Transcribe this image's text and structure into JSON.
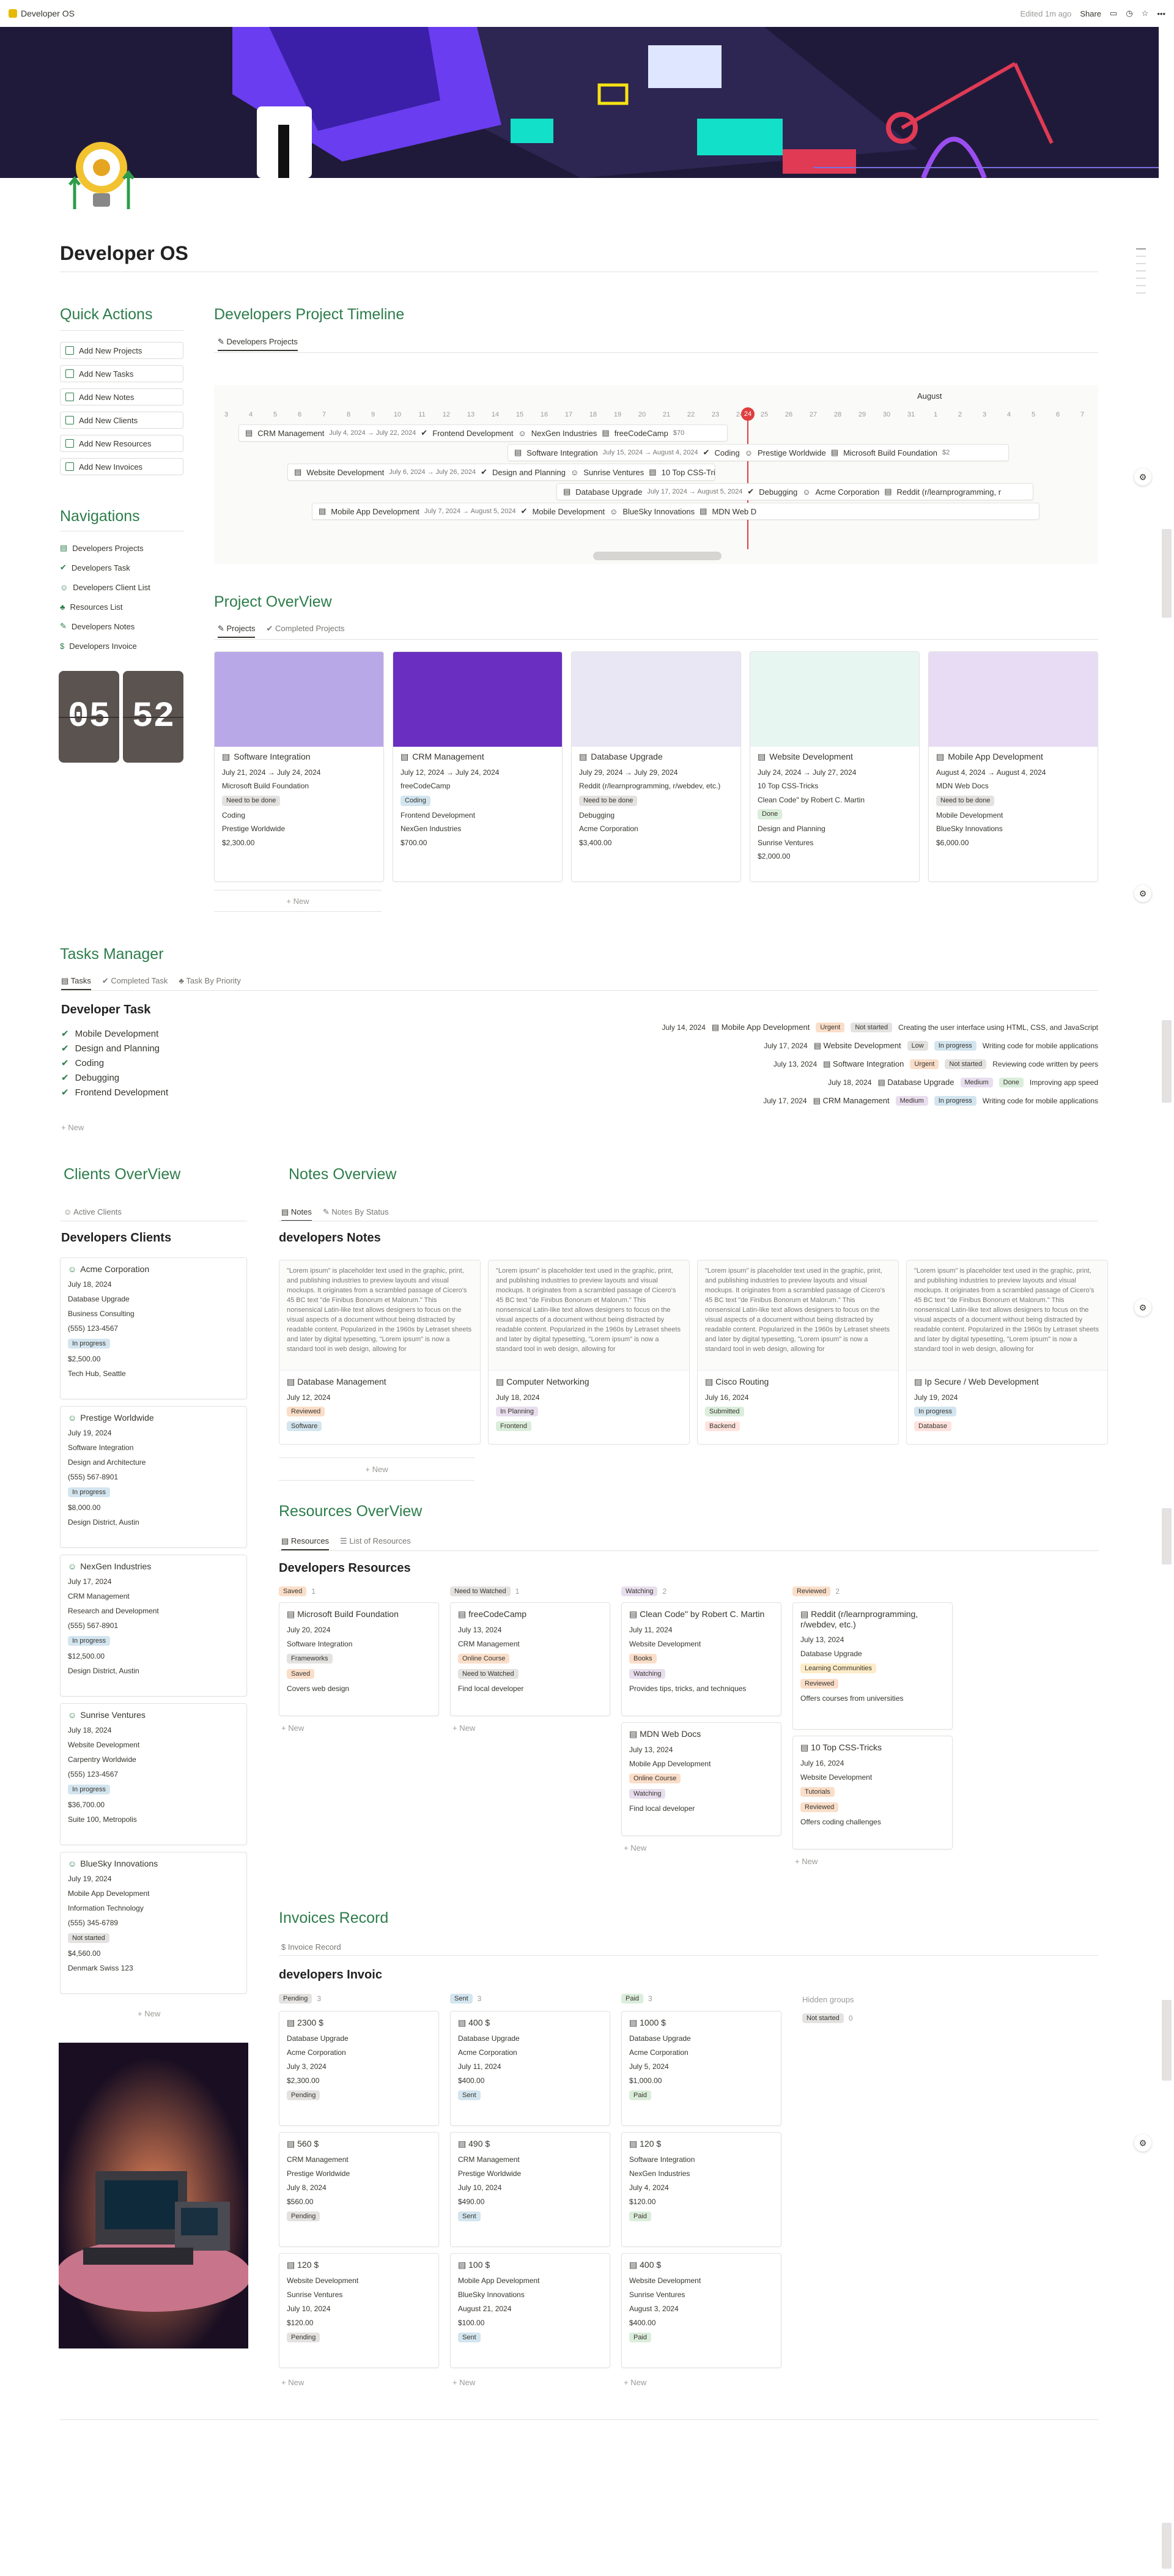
{
  "topbar": {
    "title": "Developer OS",
    "edited": "Edited 1m ago",
    "share": "Share"
  },
  "page": {
    "title": "Developer OS"
  },
  "quick_actions": {
    "title": "Quick Actions",
    "buttons": [
      "Add New Projects",
      "Add New Tasks",
      "Add New Notes",
      "Add New Clients",
      "Add New Resources",
      "Add New Invoices"
    ]
  },
  "navigations": {
    "title": "Navigations",
    "items": [
      "Developers Projects",
      "Developers Task",
      "Developers Client List",
      "Resources List",
      "Developers Notes",
      "Developers Invoice"
    ]
  },
  "clock": {
    "hours": "05",
    "minutes": "52"
  },
  "timeline": {
    "title": "Developers Project Timeline",
    "tab": "Developers Projects",
    "month": "August",
    "today": "24",
    "days": [
      "3",
      "4",
      "5",
      "6",
      "7",
      "8",
      "9",
      "10",
      "11",
      "12",
      "13",
      "14",
      "15",
      "16",
      "17",
      "18",
      "19",
      "20",
      "21",
      "22",
      "23",
      "24",
      "25",
      "26",
      "27",
      "28",
      "29",
      "30",
      "31",
      "1",
      "2",
      "3",
      "4",
      "5",
      "6",
      "7"
    ],
    "bars": [
      {
        "name": "CRM Management",
        "dates": "July 4, 2024 → July 22, 2024",
        "extra": [
          "Frontend Development",
          "NexGen Industries",
          "freeCodeCamp",
          "$70"
        ]
      },
      {
        "name": "Software Integration",
        "dates": "July 15, 2024 → August 4, 2024",
        "extra": [
          "Coding",
          "Prestige Worldwide",
          "Microsoft Build Foundation",
          "$2"
        ]
      },
      {
        "name": "Website Development",
        "dates": "July 6, 2024 → July 26, 2024",
        "extra": [
          "Design and Planning",
          "Sunrise Ventures",
          "10 Top CSS-Tricks"
        ]
      },
      {
        "name": "Database Upgrade",
        "dates": "July 17, 2024 → August 5, 2024",
        "extra": [
          "Debugging",
          "Acme Corporation",
          "Reddit (r/learnprogramming, r"
        ]
      },
      {
        "name": "Mobile App Development",
        "dates": "July 7, 2024 → August 5, 2024",
        "extra": [
          "Mobile Development",
          "BlueSky Innovations",
          "MDN Web D"
        ]
      }
    ]
  },
  "projects": {
    "title": "Project OverView",
    "tabs": [
      "Projects",
      "Completed Projects"
    ],
    "new": "+ New",
    "cards": [
      {
        "name": "Software Integration",
        "dates": "July 21, 2024 → July 24, 2024",
        "resource": "Microsoft Build Foundation",
        "status": "Need to be done",
        "task": "Coding",
        "client": "Prestige Worldwide",
        "amount": "$2,300.00"
      },
      {
        "name": "CRM Management",
        "dates": "July 12, 2024 → July 24, 2024",
        "resource": "freeCodeCamp",
        "status": "Coding",
        "task": "Frontend Development",
        "client": "NexGen Industries",
        "amount": "$700.00"
      },
      {
        "name": "Database Upgrade",
        "dates": "July 29, 2024 → July 29, 2024",
        "resource": "Reddit (r/learnprogramming, r/webdev, etc.)",
        "status": "Need to be done",
        "task": "Debugging",
        "client": "Acme Corporation",
        "amount": "$3,400.00"
      },
      {
        "name": "Website Development",
        "dates": "July 24, 2024 → July 27, 2024",
        "resource": "10 Top CSS-Tricks",
        "resource2": "Clean Code\" by Robert C. Martin",
        "status": "Done",
        "task": "Design and Planning",
        "client": "Sunrise Ventures",
        "amount": "$2,000.00"
      },
      {
        "name": "Mobile App Development",
        "dates": "August 4, 2024 → August 4, 2024",
        "resource": "MDN Web Docs",
        "status": "Need to be done",
        "task": "Mobile Development",
        "client": "BlueSky Innovations",
        "amount": "$6,000.00"
      }
    ]
  },
  "tasks": {
    "title": "Tasks Manager",
    "tabs": [
      "Tasks",
      "Completed Task",
      "Task By Priority"
    ],
    "heading": "Developer Task",
    "new": "+ New",
    "items": [
      "Mobile Development",
      "Design and Planning",
      "Coding",
      "Debugging",
      "Frontend Development"
    ],
    "rows": [
      {
        "date": "July 14, 2024",
        "project": "Mobile App Development",
        "priority": "Urgent",
        "status": "Not started",
        "desc": "Creating the user interface using HTML, CSS, and JavaScript"
      },
      {
        "date": "July 17, 2024",
        "project": "Website Development",
        "priority": "Low",
        "status": "In progress",
        "desc": "Writing code for mobile applications"
      },
      {
        "date": "July 13, 2024",
        "project": "Software Integration",
        "priority": "Urgent",
        "status": "Not started",
        "desc": "Reviewing code written by peers"
      },
      {
        "date": "July 18, 2024",
        "project": "Database Upgrade",
        "priority": "Medium",
        "status": "Done",
        "desc": "Improving app speed"
      },
      {
        "date": "July 17, 2024",
        "project": "CRM Management",
        "priority": "Medium",
        "status": "In progress",
        "desc": "Writing code for mobile applications"
      }
    ]
  },
  "clients": {
    "title": "Clients OverView",
    "tab": "Active Clients",
    "heading": "Developers Clients",
    "new": "+ New",
    "cards": [
      {
        "name": "Acme Corporation",
        "date": "July 18, 2024",
        "project": "Database Upgrade",
        "industry": "Business Consulting",
        "phone": "(555) 123-4567",
        "status": "In progress",
        "amount": "$2,500.00",
        "address": "Tech Hub, Seattle"
      },
      {
        "name": "Prestige Worldwide",
        "date": "July 19, 2024",
        "project": "Software Integration",
        "industry": "Design and Architecture",
        "phone": "(555) 567-8901",
        "status": "In progress",
        "amount": "$8,000.00",
        "address": "Design District, Austin"
      },
      {
        "name": "NexGen Industries",
        "date": "July 17, 2024",
        "project": "CRM Management",
        "industry": "Research and Development",
        "phone": "(555) 567-8901",
        "status": "In progress",
        "amount": "$12,500.00",
        "address": "Design District, Austin"
      },
      {
        "name": "Sunrise Ventures",
        "date": "July 18, 2024",
        "project": "Website Development",
        "industry": "Carpentry Worldwide",
        "phone": "(555) 123-4567",
        "status": "In progress",
        "amount": "$36,700.00",
        "address": "Suite 100, Metropolis"
      },
      {
        "name": "BlueSky Innovations",
        "date": "July 19, 2024",
        "project": "Mobile App Development",
        "industry": "Information Technology",
        "phone": "(555) 345-6789",
        "status": "Not started",
        "amount": "$4,560.00",
        "address": "Denmark Swiss 123"
      }
    ]
  },
  "notes": {
    "title": "Notes Overview",
    "tabs": [
      "Notes",
      "Notes By Status"
    ],
    "heading": "developers Notes",
    "new": "+ New",
    "lorem": "\"Lorem ipsum\" is placeholder text used in the graphic, print, and publishing industries to preview layouts and visual mockups. It originates from a scrambled passage of Cicero's 45 BC text \"de Finibus Bonorum et Malorum.\" This nonsensical Latin-like text allows designers to focus on the visual aspects of a document without being distracted by readable content. Popularized in the 1960s by Letraset sheets and later by digital typesetting, \"Lorem ipsum\" is now a standard tool in web design, allowing for",
    "cards": [
      {
        "name": "Database Management",
        "date": "July 12, 2024",
        "status": "Reviewed",
        "cat": "Software"
      },
      {
        "name": "Computer Networking",
        "date": "July 18, 2024",
        "status": "In Planning",
        "cat": "Frontend"
      },
      {
        "name": "Cisco Routing",
        "date": "July 16, 2024",
        "status": "Submitted",
        "cat": "Backend"
      },
      {
        "name": "Ip Secure / Web Development",
        "date": "July 19, 2024",
        "status": "In progress",
        "cat": "Database"
      }
    ]
  },
  "resources": {
    "title": "Resources OverView",
    "tabs": [
      "Resources",
      "List of Resources"
    ],
    "heading": "Developers Resources",
    "new": "+ New",
    "groups": [
      {
        "name": "Saved",
        "count": "1",
        "cards": [
          {
            "name": "Microsoft Build Foundation",
            "date": "July 20, 2024",
            "project": "Software Integration",
            "type": "Frameworks",
            "status": "Saved",
            "desc": "Covers web design"
          }
        ]
      },
      {
        "name": "Need to Watched",
        "count": "1",
        "cards": [
          {
            "name": "freeCodeCamp",
            "date": "July 13, 2024",
            "project": "CRM Management",
            "type": "Online Course",
            "status": "Need to Watched",
            "desc": "Find local developer"
          }
        ]
      },
      {
        "name": "Watching",
        "count": "2",
        "cards": [
          {
            "name": "Clean Code\" by Robert C. Martin",
            "date": "July 11, 2024",
            "project": "Website Development",
            "type": "Books",
            "status": "Watching",
            "desc": "Provides tips, tricks, and techniques"
          },
          {
            "name": "MDN Web Docs",
            "date": "July 13, 2024",
            "project": "Mobile App Development",
            "type": "Online Course",
            "status": "Watching",
            "desc": "Find local developer"
          }
        ]
      },
      {
        "name": "Reviewed",
        "count": "2",
        "cards": [
          {
            "name": "Reddit (r/learnprogramming, r/webdev, etc.)",
            "date": "July 13, 2024",
            "project": "Database Upgrade",
            "type": "Learning Communities",
            "status": "Reviewed",
            "desc": "Offers courses from universities"
          },
          {
            "name": "10 Top CSS-Tricks",
            "date": "July 16, 2024",
            "project": "Website Development",
            "type": "Tutorials",
            "status": "Reviewed",
            "desc": "Offers coding challenges"
          }
        ]
      }
    ]
  },
  "invoices": {
    "title": "Invoices Record",
    "tab": "Invoice Record",
    "heading": "developers Invoic",
    "new": "+ New",
    "hidden": "Hidden groups",
    "notstarted": "Not started",
    "notstarted_count": "0",
    "groups": [
      {
        "name": "Pending",
        "count": "3",
        "cards": [
          {
            "amt": "2300 $",
            "project": "Database Upgrade",
            "client": "Acme Corporation",
            "date": "July 3, 2024",
            "total": "$2,300.00",
            "status": "Pending"
          },
          {
            "amt": "560 $",
            "project": "CRM Management",
            "client": "Prestige Worldwide",
            "date": "July 8, 2024",
            "total": "$560.00",
            "status": "Pending"
          },
          {
            "amt": "120 $",
            "project": "Website Development",
            "client": "Sunrise Ventures",
            "date": "July 10, 2024",
            "total": "$120.00",
            "status": "Pending"
          }
        ]
      },
      {
        "name": "Sent",
        "count": "3",
        "cards": [
          {
            "amt": "400 $",
            "project": "Database Upgrade",
            "client": "Acme Corporation",
            "date": "July 11, 2024",
            "total": "$400.00",
            "status": "Sent"
          },
          {
            "amt": "490 $",
            "project": "CRM Management",
            "client": "Prestige Worldwide",
            "date": "July 10, 2024",
            "total": "$490.00",
            "status": "Sent"
          },
          {
            "amt": "100 $",
            "project": "Mobile App Development",
            "client": "BlueSky Innovations",
            "date": "August 21, 2024",
            "total": "$100.00",
            "status": "Sent"
          }
        ]
      },
      {
        "name": "Paid",
        "count": "3",
        "cards": [
          {
            "amt": "1000 $",
            "project": "Database Upgrade",
            "client": "Acme Corporation",
            "date": "July 5, 2024",
            "total": "$1,000.00",
            "status": "Paid"
          },
          {
            "amt": "120 $",
            "project": "Software Integration",
            "client": "NexGen Industries",
            "date": "July 4, 2024",
            "total": "$120.00",
            "status": "Paid"
          },
          {
            "amt": "400 $",
            "project": "Website Development",
            "client": "Sunrise Ventures",
            "date": "August 3, 2024",
            "total": "$400.00",
            "status": "Paid"
          }
        ]
      }
    ]
  }
}
